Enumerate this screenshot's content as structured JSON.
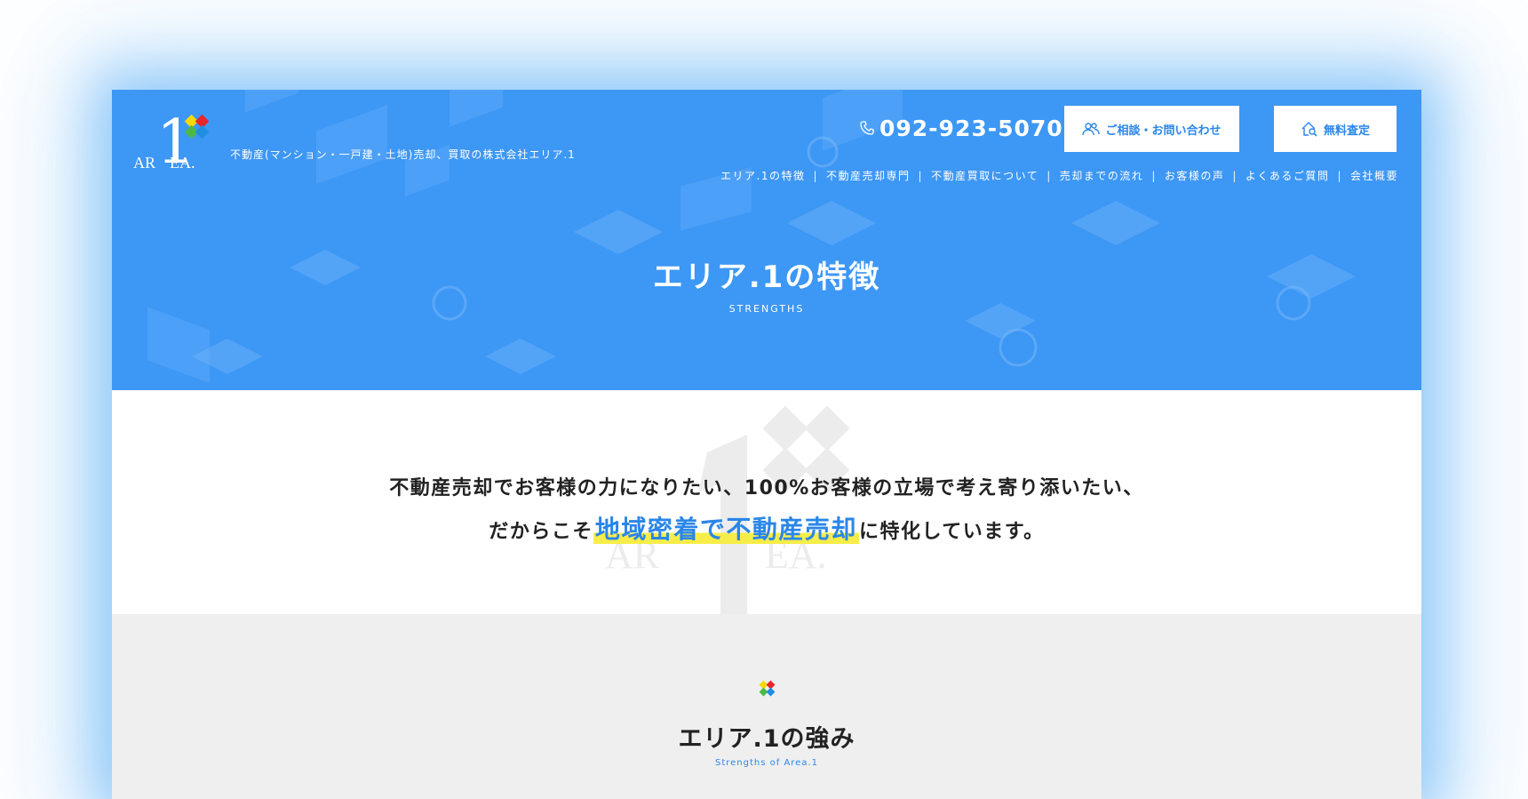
{
  "header": {
    "logo_text_left": "AR",
    "logo_text_right": "EA.",
    "logo_numeral": "1",
    "tagline": "不動産(マンション・一戸建・土地)売却、買取の株式会社エリア.1",
    "phone": "092-923-5070",
    "contact_button": "ご相談・お問い合わせ",
    "assessment_button": "無料査定",
    "nav": [
      "エリア.1の特徴",
      "不動産売却専門",
      "不動産買取について",
      "売却までの流れ",
      "お客様の声",
      "よくあるご質問",
      "会社概要"
    ]
  },
  "hero": {
    "title": "エリア.1の特徴",
    "subtitle": "STRENGTHS"
  },
  "intro": {
    "line1": "不動産売却でお客様の力になりたい、100%お客様の立場で考え寄り添いたい、",
    "line2_prefix": "だからこそ",
    "line2_highlight": "地域密着で不動産売却",
    "line2_suffix": "に特化しています。"
  },
  "strengths": {
    "title": "エリア.1の強み",
    "subtitle": "Strengths of Area.1"
  },
  "colors": {
    "hero_blue": "#3d97f5",
    "accent_blue": "#2a86e8",
    "highlight_yellow": "#f7ed4a",
    "logo_red": "#e8262b",
    "logo_yellow": "#f5d90a",
    "logo_green": "#4db848",
    "logo_blue": "#1f8ee0"
  }
}
